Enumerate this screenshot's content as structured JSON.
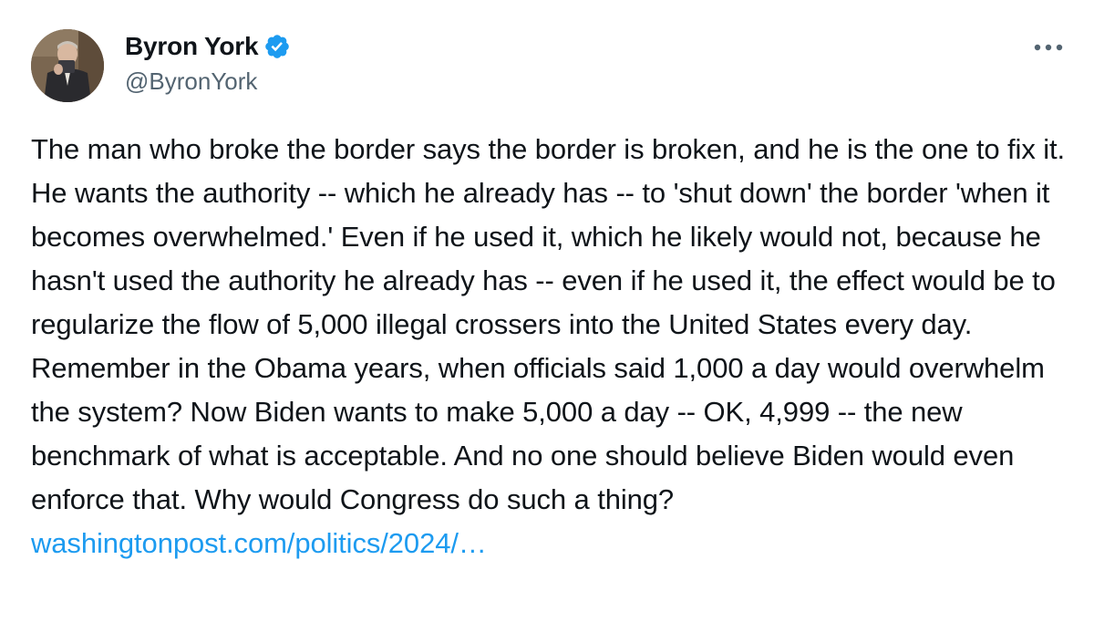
{
  "author": {
    "display_name": "Byron York",
    "handle": "@ByronYork",
    "verified": true
  },
  "menu": {
    "icon": "more-horizontal-icon"
  },
  "tweet": {
    "text": "The man who broke the border says the border is broken, and he is the one to fix it. He wants the authority -- which he already has -- to 'shut down' the border 'when it becomes overwhelmed.' Even if he used it, which he likely would not, because he hasn't used the authority he already has -- even if he used it, the effect would be to regularize the flow of 5,000 illegal crossers into the United States every day. Remember in the Obama years, when officials said 1,000 a day would overwhelm the system? Now Biden wants to make 5,000 a day -- OK, 4,999 -- the new benchmark of what is acceptable. And no one should believe Biden would even enforce that. Why would Congress do such a thing?",
    "link_text": "washingtonpost.com/politics/2024/…"
  },
  "colors": {
    "link": "#1d9bf0",
    "verified_badge": "#1d9bf0",
    "handle": "#536471",
    "text": "#0f1419"
  }
}
